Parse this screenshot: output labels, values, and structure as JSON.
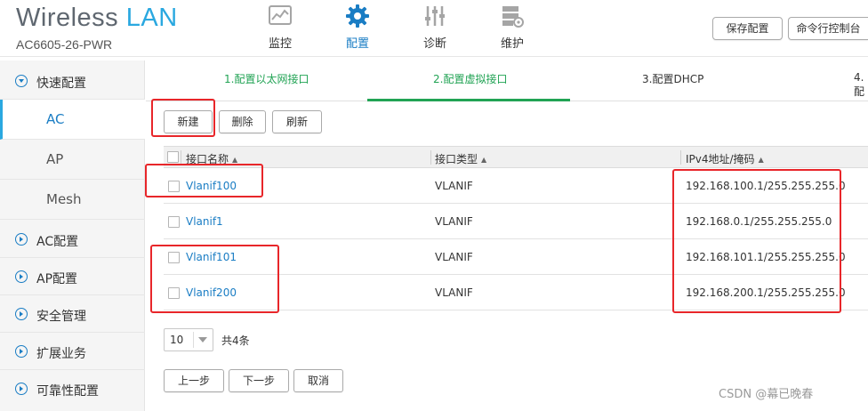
{
  "app": {
    "title_main": "Wireless",
    "title_accent": "LAN",
    "model": "AC6605-26-PWR"
  },
  "nav": {
    "items": [
      {
        "label": "监控",
        "icon": "monitor-chart-icon"
      },
      {
        "label": "配置",
        "icon": "gear-icon"
      },
      {
        "label": "诊断",
        "icon": "sliders-icon"
      },
      {
        "label": "维护",
        "icon": "server-gear-icon"
      }
    ],
    "active_index": 1
  },
  "header_buttons": {
    "save_config": "保存配置",
    "cli_console": "命令行控制台"
  },
  "sidebar": {
    "quick_config": "快速配置",
    "sub_items": [
      "AC",
      "AP",
      "Mesh"
    ],
    "active_sub": "AC",
    "groups": [
      "AC配置",
      "AP配置",
      "安全管理",
      "扩展业务",
      "可靠性配置"
    ]
  },
  "steps": [
    {
      "label": "1.配置以太网接口",
      "state": "done"
    },
    {
      "label": "2.配置虚拟接口",
      "state": "current"
    },
    {
      "label": "3.配置DHCP",
      "state": "pending"
    },
    {
      "label": "4.配",
      "state": "pending"
    }
  ],
  "toolbar": {
    "new_label": "新建",
    "delete_label": "删除",
    "refresh_label": "刷新"
  },
  "table": {
    "columns": [
      "接口名称",
      "接口类型",
      "IPv4地址/掩码"
    ],
    "sort_glyph": "▲",
    "rows": [
      {
        "name": "Vlanif100",
        "type": "VLANIF",
        "ip": "192.168.100.1/255.255.255.0"
      },
      {
        "name": "Vlanif1",
        "type": "VLANIF",
        "ip": "192.168.0.1/255.255.255.0"
      },
      {
        "name": "Vlanif101",
        "type": "VLANIF",
        "ip": "192.168.101.1/255.255.255.0"
      },
      {
        "name": "Vlanif200",
        "type": "VLANIF",
        "ip": "192.168.200.1/255.255.255.0"
      }
    ]
  },
  "pagination": {
    "page_size": "10",
    "total_text": "共4条"
  },
  "footer_buttons": {
    "prev_label": "上一步",
    "next_label": "下一步",
    "cancel_label": "取消"
  },
  "watermark": "CSDN @幕已晚春",
  "colors": {
    "accent_blue": "#2aa8e0",
    "link_blue": "#1a7dc4",
    "step_green": "#21a354",
    "annotation_red": "#e8262a"
  }
}
